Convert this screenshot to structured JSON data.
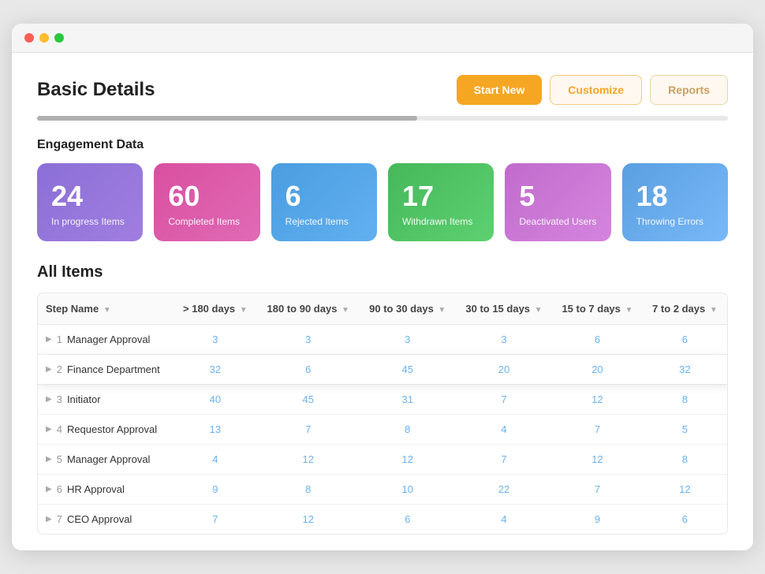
{
  "window": {
    "title": "Basic Details"
  },
  "header": {
    "title": "Basic Details",
    "buttons": {
      "start_new": "Start New",
      "customize": "Customize",
      "reports": "Reports"
    },
    "progress_percent": 55
  },
  "engagement": {
    "section_title": "Engagement Data",
    "cards": [
      {
        "number": "24",
        "label": "In progress Items",
        "color": "purple"
      },
      {
        "number": "60",
        "label": "Completed Items",
        "color": "pink"
      },
      {
        "number": "6",
        "label": "Rejected Items",
        "color": "blue"
      },
      {
        "number": "17",
        "label": "Withdrawn Items",
        "color": "green"
      },
      {
        "number": "5",
        "label": "Deactivated Users",
        "color": "lavender"
      },
      {
        "number": "18",
        "label": "Throwing Errors",
        "color": "skyblue"
      }
    ]
  },
  "all_items": {
    "section_title": "All Items",
    "columns": [
      "Step Name",
      "> 180 days",
      "180 to 90 days",
      "90 to 30 days",
      "30 to 15 days",
      "15 to 7 days",
      "7 to 2 days"
    ],
    "rows": [
      {
        "id": 1,
        "name": "Manager Approval",
        "highlighted": false,
        "vals": [
          "3",
          "3",
          "3",
          "3",
          "6",
          "6"
        ]
      },
      {
        "id": 2,
        "name": "Finance Department",
        "highlighted": true,
        "vals": [
          "32",
          "6",
          "45",
          "20",
          "20",
          "32"
        ]
      },
      {
        "id": 3,
        "name": "Initiator",
        "highlighted": false,
        "vals": [
          "40",
          "45",
          "31",
          "7",
          "12",
          "8"
        ]
      },
      {
        "id": 4,
        "name": "Requestor Approval",
        "highlighted": false,
        "vals": [
          "13",
          "7",
          "8",
          "4",
          "7",
          "5"
        ]
      },
      {
        "id": 5,
        "name": "Manager Approval",
        "highlighted": false,
        "vals": [
          "4",
          "12",
          "12",
          "7",
          "12",
          "8"
        ]
      },
      {
        "id": 6,
        "name": "HR Approval",
        "highlighted": false,
        "vals": [
          "9",
          "8",
          "10",
          "22",
          "7",
          "12"
        ]
      },
      {
        "id": 7,
        "name": "CEO Approval",
        "highlighted": false,
        "vals": [
          "7",
          "12",
          "6",
          "4",
          "9",
          "6"
        ]
      }
    ]
  }
}
